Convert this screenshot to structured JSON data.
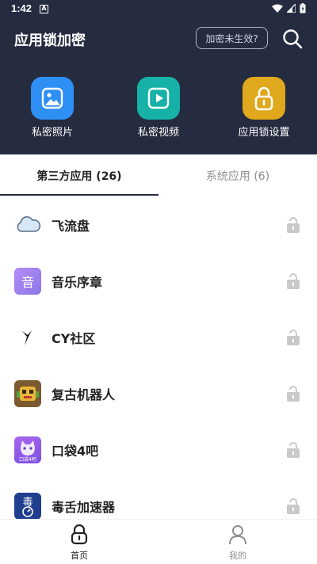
{
  "status_bar": {
    "time": "1:42",
    "notification_letter": "A"
  },
  "header": {
    "title": "应用锁加密",
    "invalid_button": "加密未生效?",
    "features": [
      {
        "label": "私密照片",
        "icon": "image-icon",
        "color": "#2e8ff5"
      },
      {
        "label": "私密视频",
        "icon": "play-icon",
        "color": "#17b2a7"
      },
      {
        "label": "应用锁设置",
        "icon": "lock-icon",
        "color": "#e0a81c"
      }
    ],
    "background": "#262c40"
  },
  "tabs": [
    {
      "label": "第三方应用 (26)",
      "active": true
    },
    {
      "label": "系统应用 (6)",
      "active": false
    }
  ],
  "apps": [
    {
      "name": "飞流盘",
      "icon": "cloud-icon",
      "locked": false
    },
    {
      "name": "音乐序章",
      "icon": "music-app-icon",
      "icon_text": "音",
      "locked": false
    },
    {
      "name": "CY社区",
      "icon": "cy-logo-icon",
      "locked": false
    },
    {
      "name": "复古机器人",
      "icon": "robot-icon",
      "locked": false
    },
    {
      "name": "口袋4吧",
      "icon": "pocket-cat-icon",
      "icon_text": "口袋4吧",
      "locked": false
    },
    {
      "name": "毒舌加速器",
      "icon": "accelerator-icon",
      "icon_text": "毒",
      "locked": false
    }
  ],
  "bottom_nav": [
    {
      "label": "首页",
      "icon": "home-lock-icon",
      "active": true
    },
    {
      "label": "我的",
      "icon": "person-icon",
      "active": false
    }
  ]
}
